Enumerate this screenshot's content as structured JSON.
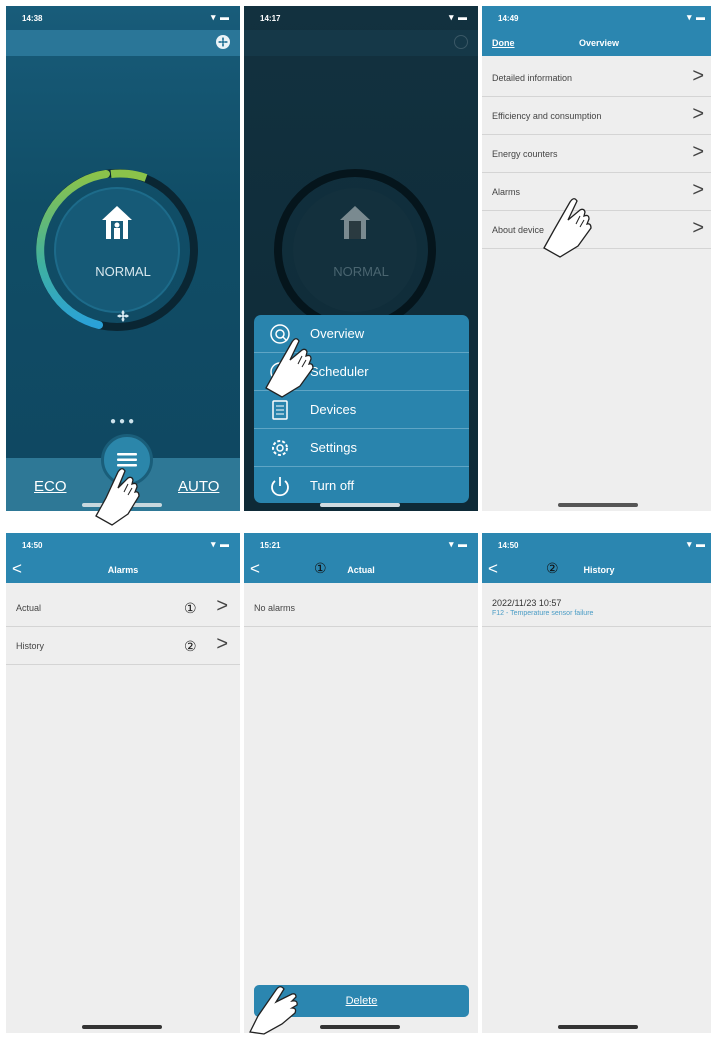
{
  "screen1": {
    "time": "14:38",
    "status_text": "NORMAL",
    "mode_left": "ECO",
    "mode_right": "AUTO"
  },
  "screen2": {
    "time": "14:17",
    "status_text": "NORMAL",
    "menu": [
      {
        "label": "Overview",
        "icon": "overview-icon"
      },
      {
        "label": "Scheduler",
        "icon": "scheduler-icon"
      },
      {
        "label": "Devices",
        "icon": "devices-icon"
      },
      {
        "label": "Settings",
        "icon": "settings-icon"
      },
      {
        "label": "Turn off",
        "icon": "power-icon"
      }
    ]
  },
  "screen3": {
    "time": "14:49",
    "done_label": "Done",
    "title": "Overview",
    "items": [
      "Detailed information",
      "Efficiency and consumption",
      "Energy counters",
      "Alarms",
      "About device"
    ]
  },
  "screen4": {
    "time": "14:50",
    "title": "Alarms",
    "items": [
      {
        "label": "Actual",
        "marker": "①"
      },
      {
        "label": "History",
        "marker": "②"
      }
    ]
  },
  "screen5": {
    "time": "15:21",
    "marker": "①",
    "title": "Actual",
    "message": "No alarms",
    "delete_label": "Delete"
  },
  "screen6": {
    "time": "14:50",
    "marker": "②",
    "title": "History",
    "entry_date": "2022/11/23 10:57",
    "entry_desc": "F12 - Temperature sensor failure"
  },
  "colors": {
    "accent": "#2b86b0",
    "ring_green": "#7fc241",
    "ring_blue": "#2fa3d6"
  }
}
